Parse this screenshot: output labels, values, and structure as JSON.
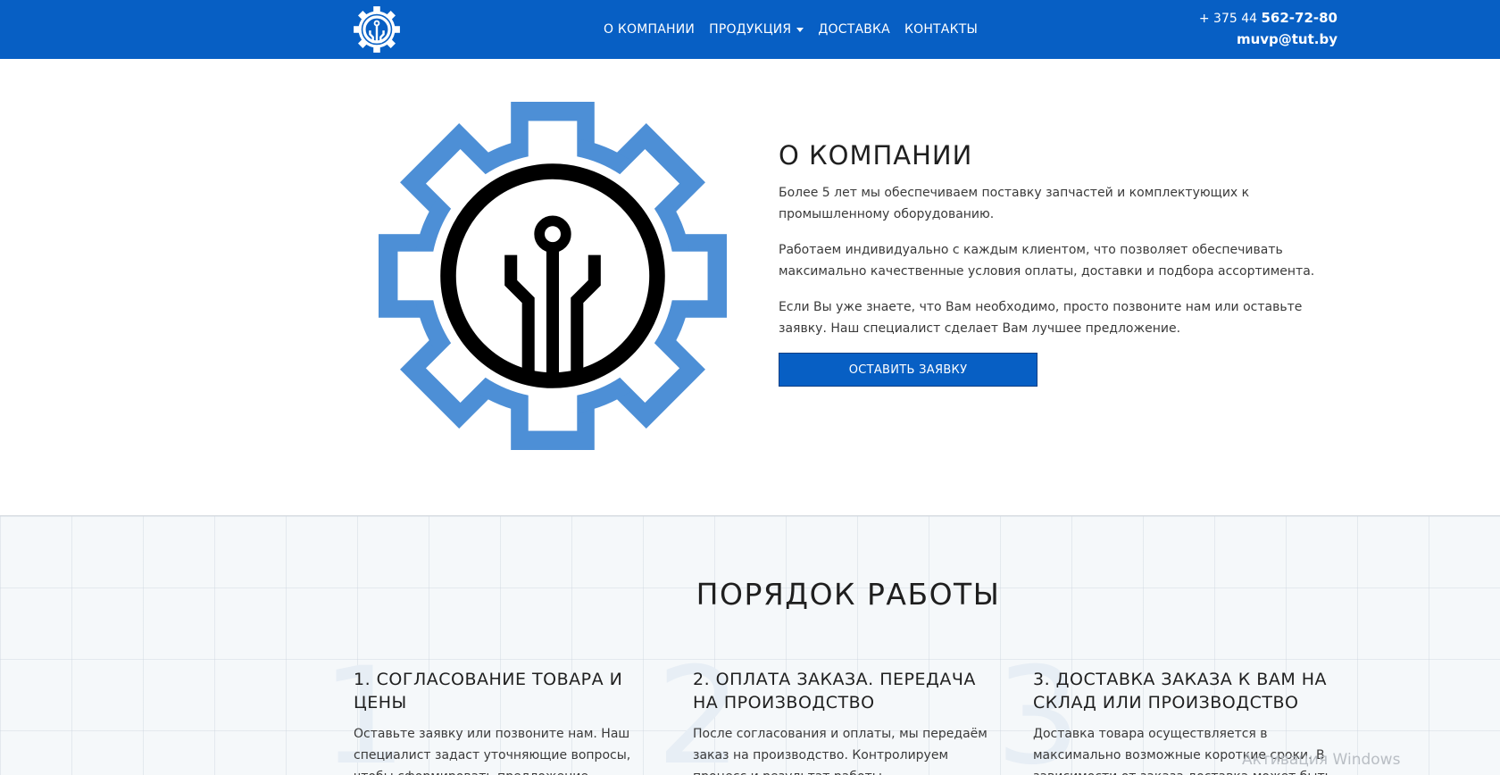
{
  "header": {
    "nav": [
      {
        "label": "О КОМПАНИИ"
      },
      {
        "label": "ПРОДУКЦИЯ"
      },
      {
        "label": "ДОСТАВКА"
      },
      {
        "label": "КОНТАКТЫ"
      }
    ],
    "phone_prefix": "+ 375 44 ",
    "phone_number": "562-72-80",
    "email": "muvp@tut.by"
  },
  "about": {
    "title": "О КОМПАНИИ",
    "paragraphs": [
      "Более 5 лет мы обеспечиваем поставку запчастей и комплектующих к промышленному оборудованию.",
      "Работаем индивидуально с каждым клиентом, что позволяет обеспечивать максимально качественные условия оплаты, доставки и подбора ассортимента.",
      "Если Вы уже знаете, что Вам необходимо, просто позвоните нам или оставьте заявку. Наш специалист сделает Вам лучшее предложение."
    ],
    "cta_label": "ОСТАВИТЬ ЗАЯВКУ"
  },
  "workflow": {
    "title": "ПОРЯДОК РАБОТЫ",
    "steps": [
      {
        "number": "1",
        "title": "1. СОГЛАСОВАНИЕ ТОВАРА И ЦЕНЫ",
        "text": "Оставьте заявку или позвоните нам. Наш специалист задаст уточняющие вопросы, чтобы сформировать предложение."
      },
      {
        "number": "2",
        "title": "2. ОПЛАТА ЗАКАЗА. ПЕРЕДАЧА НА ПРОИЗВОДСТВО",
        "text": "После согласования и оплаты, мы передаём заказ на производство. Контролируем процесс и результат работы."
      },
      {
        "number": "3",
        "title": "3. ДОСТАВКА ЗАКАЗА К ВАМ НА СКЛАД ИЛИ ПРОИЗВОДСТВО",
        "text": "Доставка товара осуществляется в максимально возможные короткие сроки. В зависимости от заказа доставка может быть."
      }
    ]
  },
  "watermark": "Активация Windows",
  "colors": {
    "brand_blue": "#075fc4",
    "gear_blue": "#4d8fd6",
    "dark": "#000000"
  },
  "icons": [
    "gear-circuit-logo-icon",
    "gear-circuit-illustration",
    "chevron-down-icon"
  ]
}
